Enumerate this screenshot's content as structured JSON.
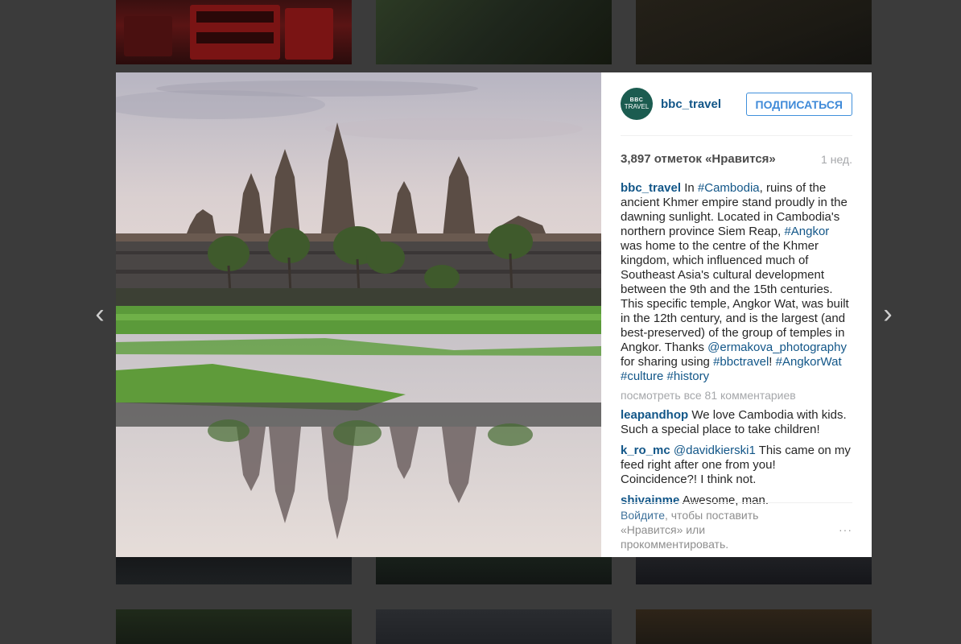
{
  "post": {
    "username": "bbc_travel",
    "avatar_text_top": "BBC",
    "avatar_text_bottom": "TRAVEL",
    "follow_label": "ПОДПИСАТЬСЯ",
    "likes_text": "3,897 отметок «Нравится»",
    "time_ago": "1 нед.",
    "caption": [
      {
        "t": "user",
        "v": "bbc_travel"
      },
      {
        "t": "text",
        "v": " In "
      },
      {
        "t": "tag",
        "v": "#Cambodia"
      },
      {
        "t": "text",
        "v": ", ruins of the ancient Khmer empire stand proudly in the dawning sunlight. Located in Cambodia's northern province Siem Reap, "
      },
      {
        "t": "tag",
        "v": "#Angkor"
      },
      {
        "t": "text",
        "v": " was home to the centre of the Khmer kingdom, which influenced much of Southeast Asia's cultural development between the 9th and the 15th centuries. This specific temple, Angkor Wat, was built in the 12th century, and is the largest (and best-preserved) of the group of temples in Angkor. Thanks "
      },
      {
        "t": "tag",
        "v": "@ermakova_photography"
      },
      {
        "t": "text",
        "v": " for sharing using "
      },
      {
        "t": "tag",
        "v": "#bbctravel"
      },
      {
        "t": "text",
        "v": "! "
      },
      {
        "t": "tag",
        "v": "#AngkorWat"
      },
      {
        "t": "text",
        "v": " "
      },
      {
        "t": "tag",
        "v": "#culture"
      },
      {
        "t": "text",
        "v": " "
      },
      {
        "t": "tag",
        "v": "#history"
      }
    ],
    "view_all_comments": "посмотреть все 81 комментариев",
    "comments": [
      {
        "user": "leapandhop",
        "parts": [
          {
            "t": "text",
            "v": " We love Cambodia with kids. Such a special place to take children!"
          }
        ]
      },
      {
        "user": "k_ro_mc",
        "parts": [
          {
            "t": "text",
            "v": " "
          },
          {
            "t": "tag",
            "v": "@davidkierski1"
          },
          {
            "t": "text",
            "v": " This came on my feed right after one from you! Coincidence?! I think not."
          }
        ]
      },
      {
        "user": "shivainme",
        "parts": [
          {
            "t": "text",
            "v": " Awesome, man."
          }
        ]
      }
    ],
    "login_link": "Войдите",
    "login_rest": ", чтобы поставить «Нравится» или прокомментировать.",
    "more_icon": "···"
  },
  "nav": {
    "prev_icon": "‹",
    "next_icon": "›"
  },
  "colors": {
    "link": "#125688",
    "follow_blue": "#3f8ad8",
    "backdrop": "#3b3b3b"
  }
}
